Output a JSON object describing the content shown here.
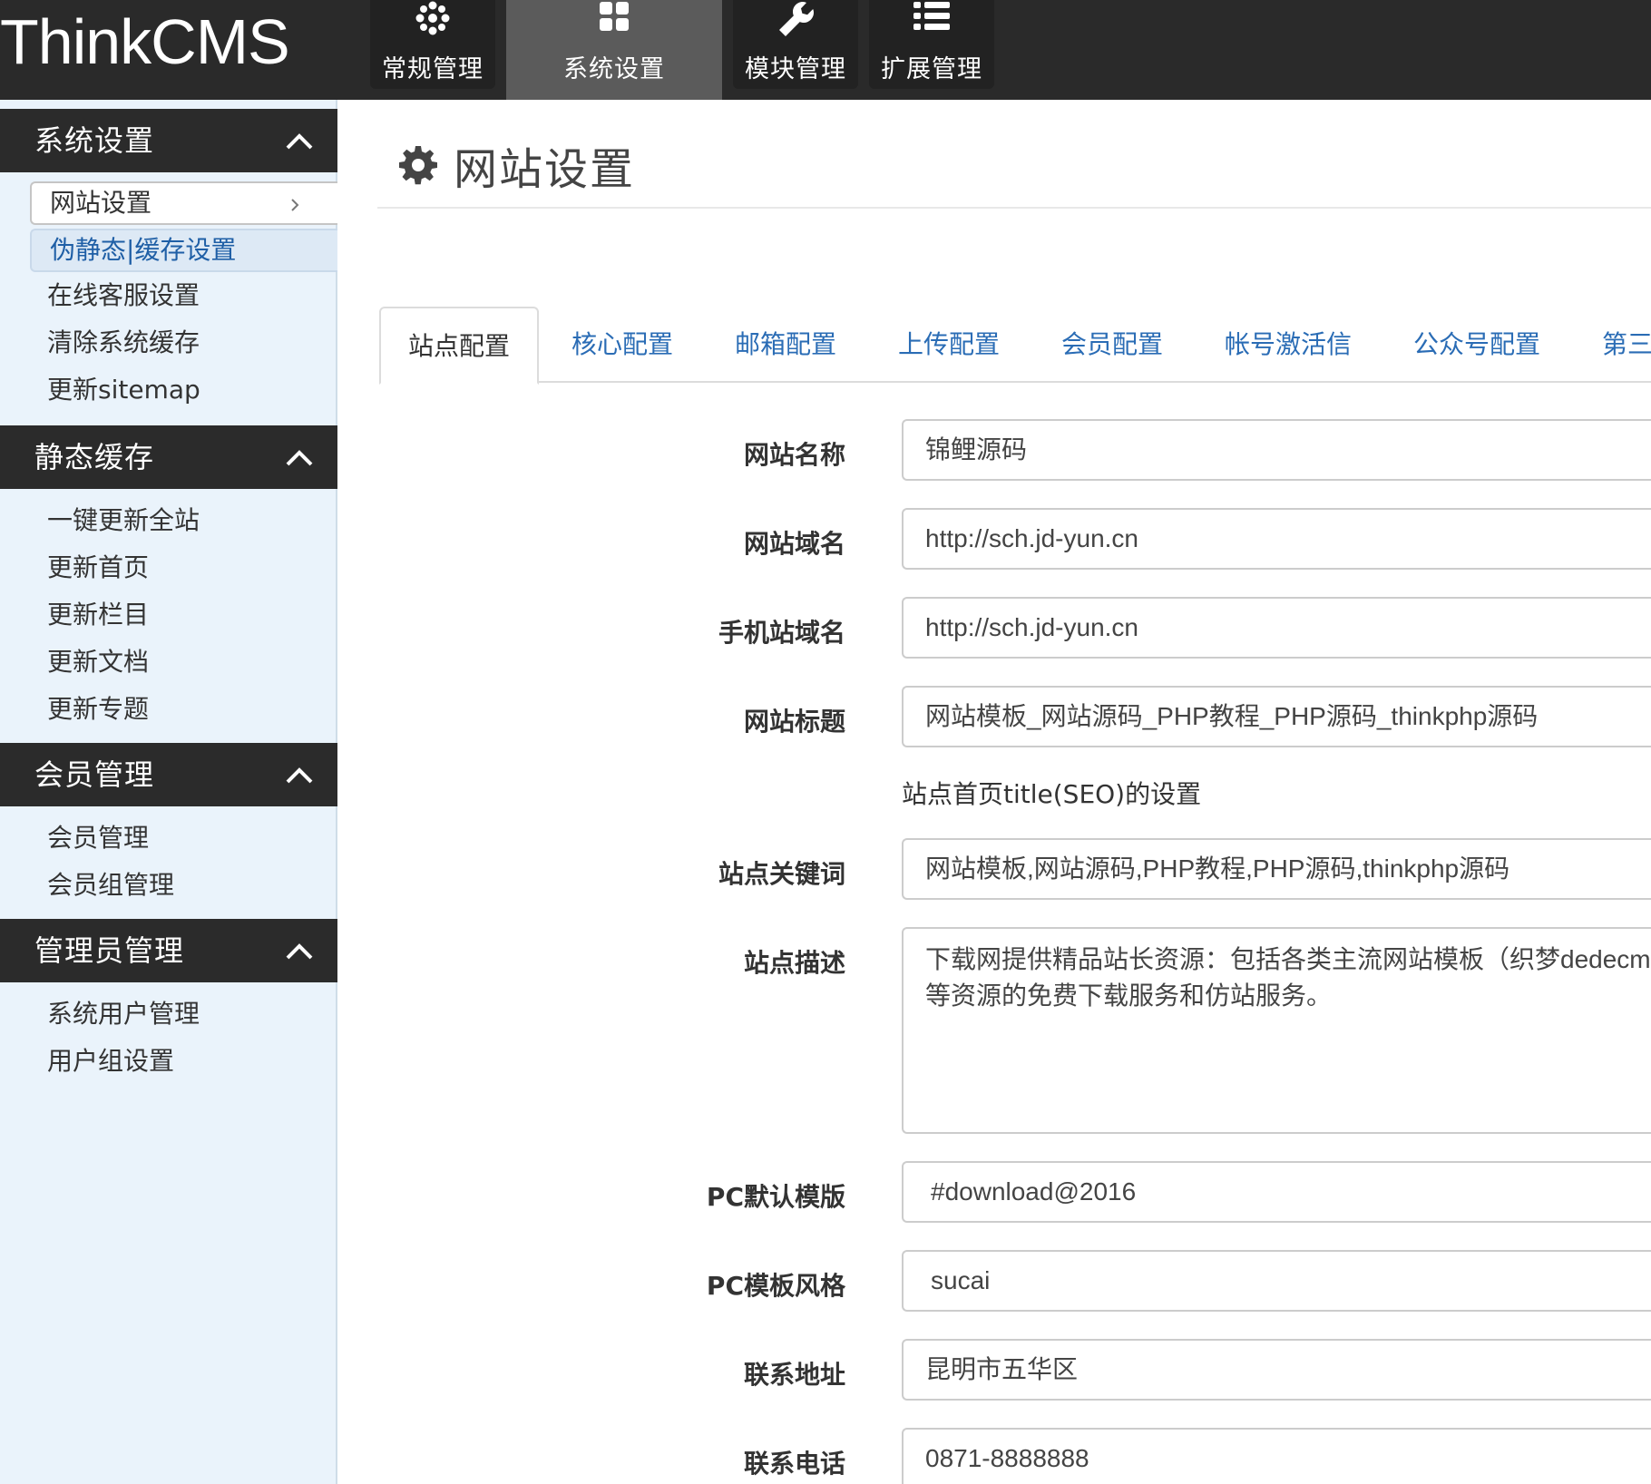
{
  "app": {
    "logo": "ThinkCMS"
  },
  "topnav": [
    {
      "label": "常规管理",
      "icon": "flower-icon"
    },
    {
      "label": "系统设置",
      "icon": "grid-icon"
    },
    {
      "label": "模块管理",
      "icon": "wrench-icon"
    },
    {
      "label": "扩展管理",
      "icon": "list-icon"
    }
  ],
  "sidebar": {
    "groups": [
      {
        "title": "系统设置",
        "items": [
          "网站设置",
          "伪静态|缓存设置",
          "在线客服设置",
          "清除系统缓存",
          "更新sitemap"
        ]
      },
      {
        "title": "静态缓存",
        "items": [
          "一键更新全站",
          "更新首页",
          "更新栏目",
          "更新文档",
          "更新专题"
        ]
      },
      {
        "title": "会员管理",
        "items": [
          "会员管理",
          "会员组管理"
        ]
      },
      {
        "title": "管理员管理",
        "items": [
          "系统用户管理",
          "用户组设置"
        ]
      }
    ]
  },
  "page": {
    "title": "网站设置"
  },
  "tabs": [
    "站点配置",
    "核心配置",
    "邮箱配置",
    "上传配置",
    "会员配置",
    "帐号激活信",
    "公众号配置",
    "第三"
  ],
  "form": {
    "site_name": {
      "label": "网站名称",
      "value": "锦鲤源码"
    },
    "site_domain": {
      "label": "网站域名",
      "value": "http://sch.jd-yun.cn"
    },
    "mobile_domain": {
      "label": "手机站域名",
      "value": "http://sch.jd-yun.cn"
    },
    "site_title": {
      "label": "网站标题",
      "value": "网站模板_网站源码_PHP教程_PHP源码_thinkphp源码",
      "help": "站点首页title(SEO)的设置"
    },
    "keywords": {
      "label": "站点关键词",
      "value": "网站模板,网站源码,PHP教程,PHP源码,thinkphp源码"
    },
    "description": {
      "label": "站点描述",
      "value": "下载网提供精品站长资源：包括各类主流网站模板（织梦dedecms\n等资源的免费下载服务和仿站服务。"
    },
    "pc_template": {
      "label": "PC默认模版",
      "value": "#download@2016"
    },
    "pc_style": {
      "label": "PC模板风格",
      "value": "sucai"
    },
    "address": {
      "label": "联系地址",
      "value": "昆明市五华区"
    },
    "phone": {
      "label": "联系电话",
      "value": "0871-8888888"
    }
  }
}
